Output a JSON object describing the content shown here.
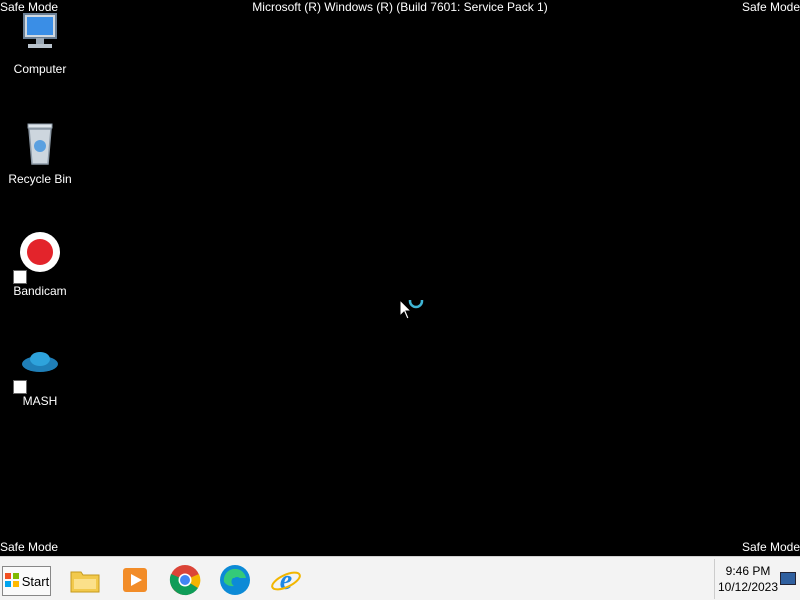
{
  "overlay": {
    "safe_mode_tl": "Safe Mode",
    "safe_mode_tr": "Safe Mode",
    "safe_mode_bl": "Safe Mode",
    "safe_mode_br": "Safe Mode",
    "title": "Microsoft (R) Windows (R) (Build 7601: Service Pack 1)"
  },
  "desktop_icons": [
    {
      "label": "Computer",
      "icon": "computer-icon"
    },
    {
      "label": "Recycle Bin",
      "icon": "recycle-bin-icon"
    },
    {
      "label": "Bandicam",
      "icon": "bandicam-icon"
    },
    {
      "label": "MASH",
      "icon": "mash-icon"
    }
  ],
  "taskbar": {
    "start_label": "Start",
    "pinned": [
      "file-explorer-icon",
      "media-player-icon",
      "chrome-icon",
      "edge-icon",
      "internet-explorer-icon"
    ],
    "clock_time": "9:46 PM",
    "clock_date": "10/12/2023"
  },
  "colors": {
    "desktop_bg": "#000000",
    "taskbar_bg": "#f3f3f3",
    "bandicam_red": "#e3242b"
  }
}
